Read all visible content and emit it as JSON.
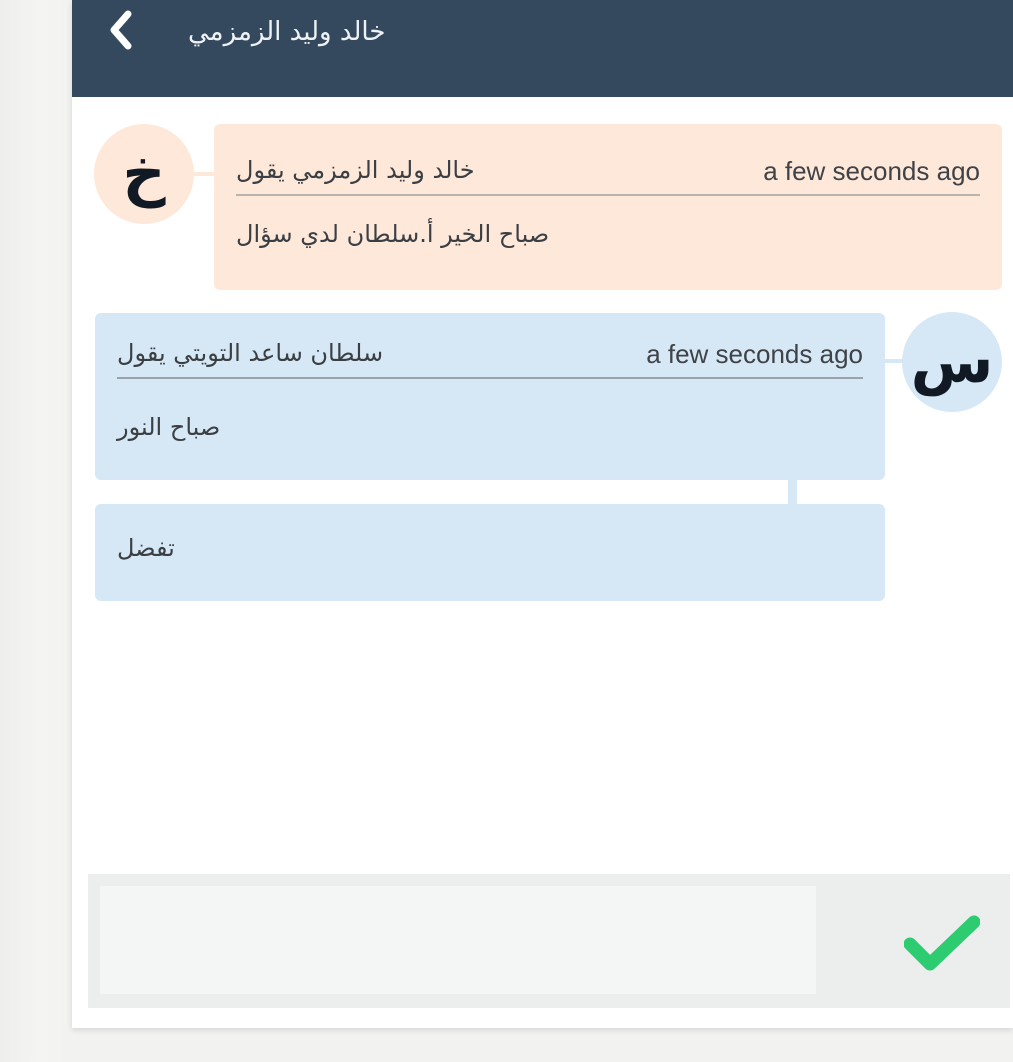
{
  "header": {
    "title": "خالد وليد الزمزمي"
  },
  "messages": [
    {
      "direction": "incoming",
      "avatar_letter": "خ",
      "author_line": "خالد وليد الزمزمي يقول",
      "time": "a few seconds ago",
      "text": "صباح الخير أ.سلطان لدي سؤال"
    },
    {
      "direction": "outgoing",
      "avatar_letter": "س",
      "author_line": "سلطان ساعد التويتي يقول",
      "time": "a few seconds ago",
      "text": "صباح النور"
    },
    {
      "direction": "outgoing",
      "text": "تفضل"
    }
  ],
  "composer": {
    "value": "",
    "placeholder": ""
  },
  "icons": {
    "back": "chevron-left-icon",
    "send": "checkmark-icon"
  },
  "colors": {
    "header_background": "#34495e",
    "incoming_bubble": "#fde8da",
    "outgoing_bubble": "#d6e8f5",
    "send_check": "#2ecc71"
  }
}
